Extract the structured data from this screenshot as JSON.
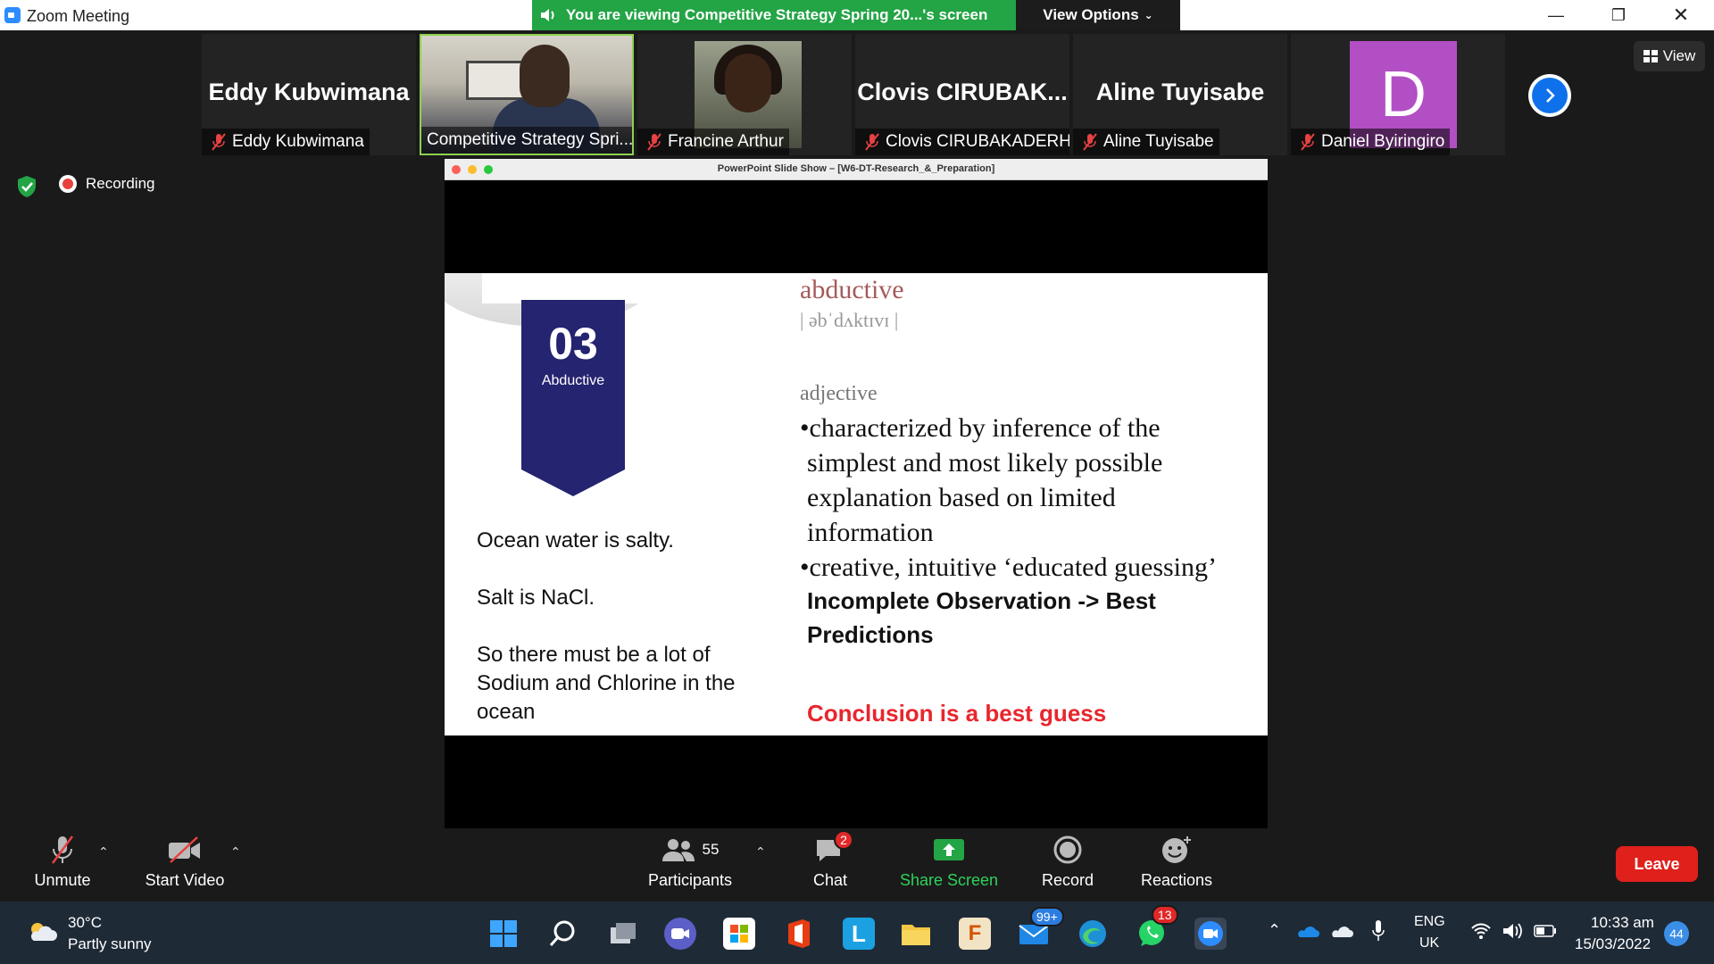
{
  "window": {
    "title": "Zoom Meeting",
    "share_banner": "You are viewing Competitive Strategy Spring 20...'s screen",
    "view_options": "View Options",
    "view_button": "View"
  },
  "participants": [
    {
      "big_name": "Eddy Kubwimana",
      "label": "Eddy Kubwimana"
    },
    {
      "big_name": "",
      "label": "Competitive Strategy Spri..."
    },
    {
      "big_name": "",
      "label": "Francine Arthur"
    },
    {
      "big_name": "Clovis  CIRUBAK...",
      "label": "Clovis CIRUBAKADERHA"
    },
    {
      "big_name": "Aline Tuyisabe",
      "label": "Aline Tuyisabe"
    },
    {
      "big_name": "",
      "label": "Daniel Byiringiro",
      "avatar_letter": "D",
      "avatar_color": "#b24fc4"
    }
  ],
  "status": {
    "recording": "Recording"
  },
  "slideshow": {
    "window_title": "PowerPoint Slide Show – [W6-DT-Research_&_Preparation]",
    "ribbon_number": "03",
    "ribbon_label": "Abductive",
    "left_text": {
      "line1": "Ocean water is salty.",
      "line2": "Salt is NaCl.",
      "line3a": "So there must be a lot of",
      "line3b": "Sodium and Chlorine in the",
      "line3c": "ocean"
    },
    "word": "abductive",
    "phonetic": "| əbˈdʌktɪvɪ |",
    "part_of_speech": "adjective",
    "def1_a": "•characterized by inference of the",
    "def1_b": "simplest and most likely possible",
    "def1_c": "explanation based on limited",
    "def1_d": "information",
    "def2": "•creative, intuitive ‘educated guessing’",
    "bold_a": "Incomplete Observation -> Best",
    "bold_b": "Predictions",
    "red": "Conclusion is a best guess"
  },
  "toolbar": {
    "unmute": "Unmute",
    "start_video": "Start Video",
    "participants": "Participants",
    "participants_count": "55",
    "chat": "Chat",
    "chat_badge": "2",
    "share_screen": "Share Screen",
    "record": "Record",
    "reactions": "Reactions",
    "leave": "Leave"
  },
  "taskbar": {
    "weather_temp": "30°C",
    "weather_desc": "Partly sunny",
    "mail_badge": "99+",
    "whatsapp_badge": "13",
    "lang_top": "ENG",
    "lang_bottom": "UK",
    "time": "10:33 am",
    "date": "15/03/2022",
    "notifications": "44"
  },
  "colors": {
    "share_green": "#23a445",
    "leave_red": "#e0201b",
    "accent_blue": "#0e71eb"
  }
}
